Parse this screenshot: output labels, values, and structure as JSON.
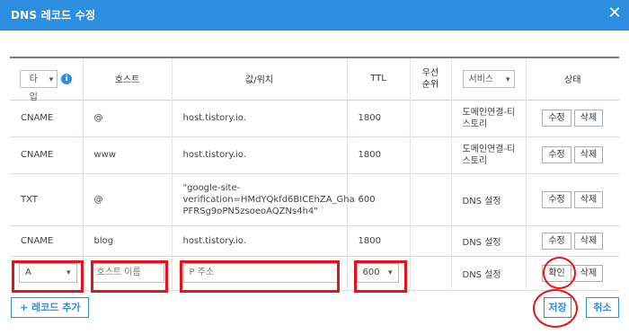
{
  "dialog": {
    "title": "DNS 레코드 수정",
    "close_glyph": "✕"
  },
  "header": {
    "type": "타입",
    "info": "i",
    "host": "호스트",
    "value": "값/위치",
    "ttl": "TTL",
    "priority": "우선\n순위",
    "service": "서비스",
    "status": "상태"
  },
  "rows": [
    {
      "type": "CNAME",
      "host": "@",
      "value": "host.tistory.io.",
      "ttl": "1800",
      "service": "도메인연결-티\n스토리",
      "edit": "수정",
      "delete": "삭제"
    },
    {
      "type": "CNAME",
      "host": "www",
      "value": "host.tistory.io.",
      "ttl": "1800",
      "service": "도메인연결-티\n스토리",
      "edit": "수정",
      "delete": "삭제"
    },
    {
      "type": "TXT",
      "host": "@",
      "value": "\"google-site-\nverification=HMdYQkfd6BICEhZA_Gha\nPFRSg9oPN5zsoeoAQZNs4h4\"",
      "ttl": "600",
      "service": "DNS 설정",
      "edit": "수정",
      "delete": "삭제"
    },
    {
      "type": "CNAME",
      "host": "blog",
      "value": "host.tistory.io.",
      "ttl": "1800",
      "service": "DNS 설정",
      "edit": "수정",
      "delete": "삭제"
    }
  ],
  "new_row": {
    "type_value": "A",
    "host_placeholder": "호스트 이름",
    "value_placeholder": "P 주소",
    "ttl_value": "600",
    "service": "DNS 설정",
    "confirm": "확인",
    "delete": "삭제"
  },
  "footer": {
    "add": "+ 레코드 추가",
    "save": "저장",
    "cancel": "취소"
  },
  "colors": {
    "accent": "#2d8ee0",
    "highlight": "#e5141b"
  },
  "icons": {
    "dropdown": "chevron-down-icon",
    "close": "close-icon",
    "info": "info-icon"
  }
}
